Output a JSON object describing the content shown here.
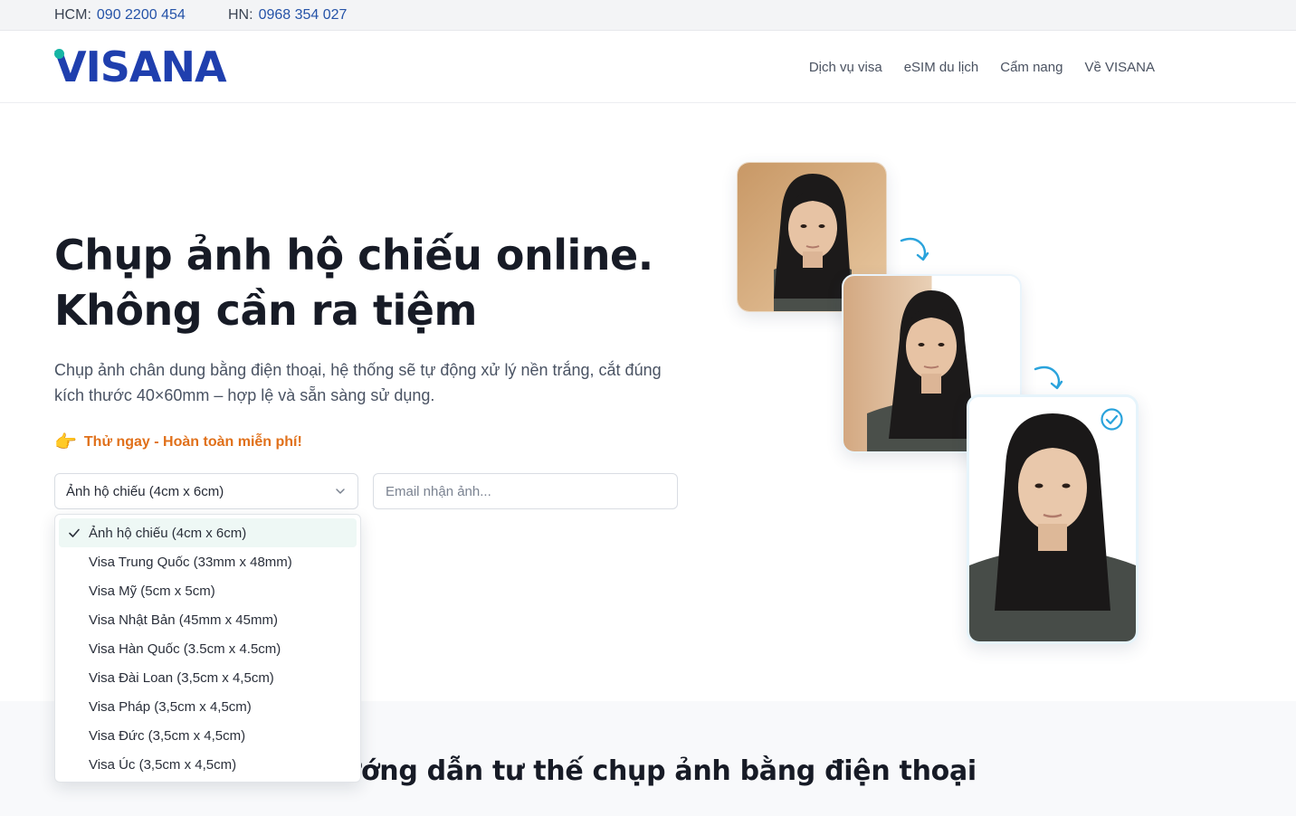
{
  "topbar": {
    "hcm_label": "HCM:",
    "hcm_phone": "090 2200 454",
    "hn_label": "HN:",
    "hn_phone": "0968 354 027"
  },
  "header": {
    "logo_text": "VISANA",
    "nav": [
      "Dịch vụ visa",
      "eSIM du lịch",
      "Cẩm nang",
      "Về VISANA"
    ]
  },
  "hero": {
    "title_line1": "Chụp ảnh hộ chiếu online.",
    "title_line2": "Không cần ra tiệm",
    "description": "Chụp ảnh chân dung bằng điện thoại, hệ thống sẽ tự động xử lý nền trắng, cắt đúng kích thước 40×60mm – hợp lệ và sẵn sàng sử dụng.",
    "cta_text": "Thử ngay - Hoàn toàn miễn phí!",
    "cta_icon": "pointing-hand-icon"
  },
  "form": {
    "selected": "Ảnh hộ chiếu (4cm x 6cm)",
    "email_placeholder": "Email nhận ảnh...",
    "options": [
      "Ảnh hộ chiếu (4cm x 6cm)",
      "Visa Trung Quốc (33mm x 48mm)",
      "Visa Mỹ (5cm x 5cm)",
      "Visa Nhật Bản (45mm x 45mm)",
      "Visa Hàn Quốc (3.5cm x 4.5cm)",
      "Visa Đài Loan (3,5cm x 4,5cm)",
      "Visa Pháp (3,5cm x 4,5cm)",
      "Visa Đức (3,5cm x 4,5cm)",
      "Visa Úc (3,5cm x 4,5cm)"
    ]
  },
  "section2": {
    "heading": "Hướng dẫn tư thế chụp ảnh bằng điện thoại"
  },
  "colors": {
    "brand_blue": "#1f3fae",
    "brand_teal": "#16b5a4",
    "cta_orange": "#e0701a",
    "arrow_blue": "#2aa3dc"
  }
}
